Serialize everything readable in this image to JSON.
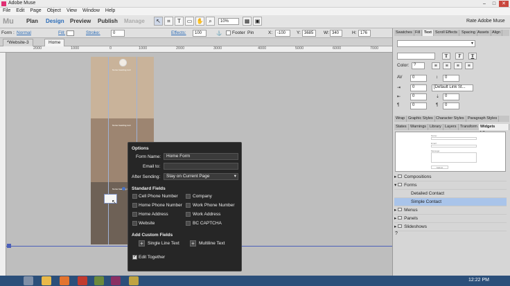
{
  "window": {
    "title": "Adobe Muse"
  },
  "menu": [
    "File",
    "Edit",
    "Page",
    "Object",
    "View",
    "Window",
    "Help"
  ],
  "appbar": {
    "logo": "Mu",
    "tabs": [
      {
        "label": "Plan",
        "state": "normal"
      },
      {
        "label": "Design",
        "state": "active"
      },
      {
        "label": "Preview",
        "state": "normal"
      },
      {
        "label": "Publish",
        "state": "normal"
      },
      {
        "label": "Manage",
        "state": "disabled"
      }
    ],
    "zoom": "10%",
    "rate_link": "Rate Adobe Muse"
  },
  "controlbar": {
    "form_label": "Form :",
    "form_state": "Normal",
    "fill_label": "Fill:",
    "stroke_label": "Stroke:",
    "stroke_value": "0",
    "effects_label": "Effects:",
    "effects_value": "100",
    "footer_label": "Footer",
    "pin_label": "Pin",
    "x_label": "X:",
    "x_value": "-100",
    "y_label": "Y:",
    "y_value": "3685",
    "w_label": "W:",
    "w_value": "340",
    "h_label": "H:",
    "h_value": "176"
  },
  "document_tabs": [
    {
      "label": "*Website-3",
      "selected": false
    },
    {
      "label": "Home",
      "selected": true
    }
  ],
  "ruler": [
    "2000",
    "1000",
    "0",
    "1000",
    "2000",
    "3000",
    "4000",
    "5000",
    "6000",
    "7000"
  ],
  "page": {
    "section_title": "Some heading text"
  },
  "options_popup": {
    "title": "Options",
    "form_name_label": "Form Name:",
    "form_name_value": "Home Form",
    "email_label": "Email to:",
    "email_value": "",
    "after_sending_label": "After Sending:",
    "after_sending_value": "Stay on Current Page",
    "standard_fields_title": "Standard Fields",
    "fields": [
      "Cell Phone Number",
      "Company",
      "Home Phone Number",
      "Work Phone Number",
      "Home Address",
      "Work Address",
      "Website",
      "BC CAPTCHA"
    ],
    "custom_fields_title": "Add Custom Fields",
    "single_line": "Single Line Text",
    "multiline": "Multiline Text",
    "edit_together": "Edit Together"
  },
  "right_panel": {
    "top_tabs": [
      "Swatches",
      "Fill",
      "Text",
      "Scroll Effects",
      "Spacing",
      "Assets",
      "Align"
    ],
    "text_values": {
      "color_label": "Color:",
      "color_value": "?",
      "size_value": "?",
      "tracking": "0",
      "leading": "0",
      "indent1": "0",
      "indent2": "0",
      "space1": "0",
      "space2": "0",
      "space3": "0",
      "link_style": "[Default Link St..."
    },
    "mid_tabs_1": [
      "Wrap",
      "Graphic Styles",
      "Character Styles",
      "Paragraph Styles"
    ],
    "mid_tabs_2": [
      "States",
      "Warnings",
      "Library",
      "Layers",
      "Transform",
      "Widgets Library"
    ],
    "preview": {
      "name_label": "Name:",
      "email_label": "Email:",
      "message_label": "Message:",
      "submit_label": "Submit"
    },
    "tree": [
      {
        "label": "Compositions",
        "indent": 0,
        "selected": false
      },
      {
        "label": "Forms",
        "indent": 0,
        "selected": false,
        "open": true
      },
      {
        "label": "Detailed Contact",
        "indent": 1,
        "selected": false
      },
      {
        "label": "Simple Contact",
        "indent": 1,
        "selected": true
      },
      {
        "label": "Menus",
        "indent": 0,
        "selected": false
      },
      {
        "label": "Panels",
        "indent": 0,
        "selected": false
      },
      {
        "label": "Slideshows",
        "indent": 0,
        "selected": false
      }
    ]
  },
  "taskbar": {
    "clock": "12:22 PM"
  },
  "colors": {
    "accent": "#2b6cb8",
    "popup_bg": "#262626",
    "band1": "#c9b39a",
    "band2": "#9d8571",
    "band3": "#6e6156",
    "selected_tree": "#a9c4ea"
  }
}
